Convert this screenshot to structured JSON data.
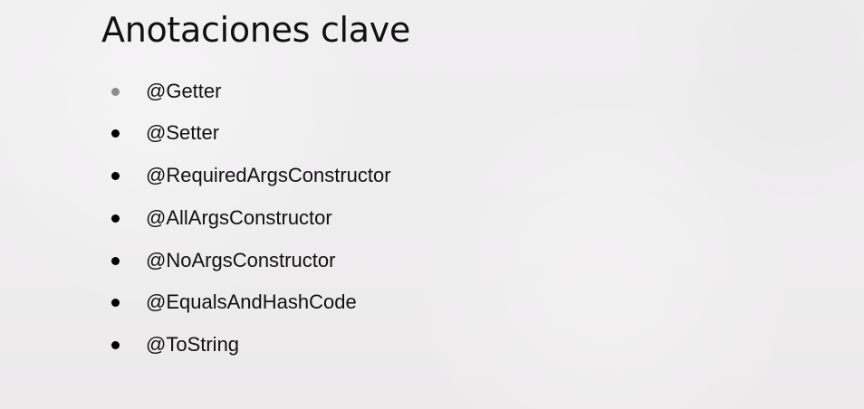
{
  "slide": {
    "title": "Anotaciones clave",
    "items": [
      {
        "label": "@Getter",
        "bullet_color": "#8c8c8c"
      },
      {
        "label": "@Setter",
        "bullet_color": "#000000"
      },
      {
        "label": "@RequiredArgsConstructor",
        "bullet_color": "#000000"
      },
      {
        "label": "@AllArgsConstructor",
        "bullet_color": "#000000"
      },
      {
        "label": "@NoArgsConstructor",
        "bullet_color": "#000000"
      },
      {
        "label": "@EqualsAndHashCode",
        "bullet_color": "#000000"
      },
      {
        "label": "@ToString",
        "bullet_color": "#000000"
      }
    ]
  },
  "colors": {
    "background": "#eeedee",
    "text": "#111111"
  }
}
